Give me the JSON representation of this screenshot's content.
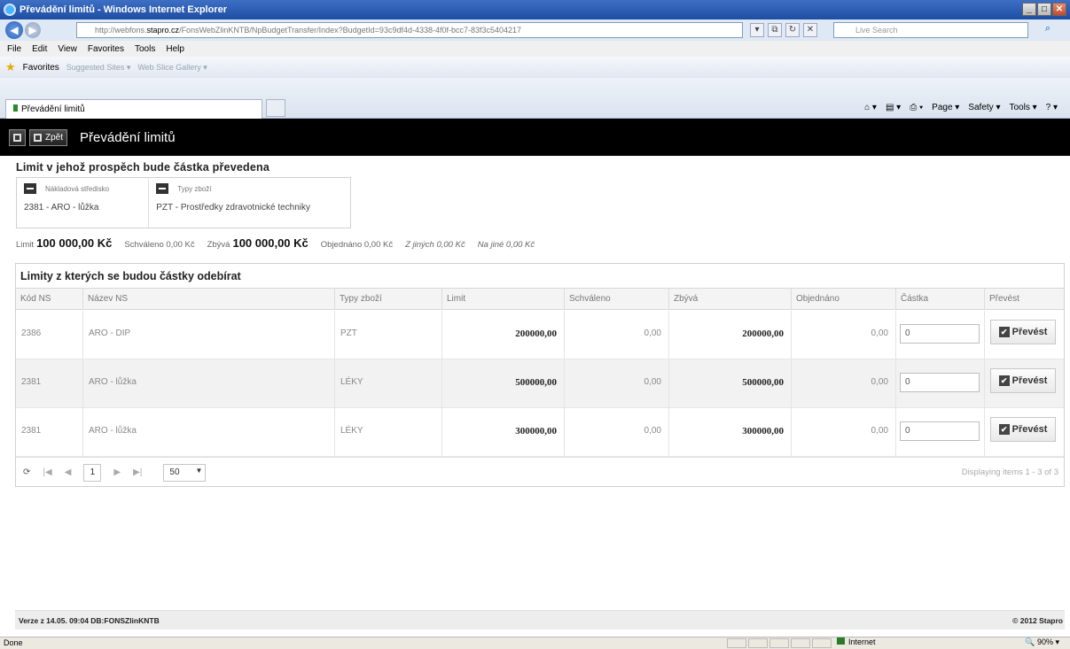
{
  "browser": {
    "window_title": "Převádění limitů - Windows Internet Explorer",
    "url_prefix": "http://webfons.",
    "url_host": "stapro.cz",
    "url_rest": "/FonsWebZlinKNTB/NpBudgetTransfer/Index?BudgetId=93c9df4d-4338-4f0f-bcc7-83f3c5404217",
    "search_placeholder": "Live Search",
    "menu": [
      "File",
      "Edit",
      "View",
      "Favorites",
      "Tools",
      "Help"
    ],
    "favorites_label": "Favorites",
    "suggested_sites": "Suggested Sites ▾",
    "web_slice": "Web Slice Gallery ▾",
    "tab_title": "Převádění limitů",
    "commands": [
      "Page ▾",
      "Safety ▾",
      "Tools ▾"
    ],
    "status_text": "Done",
    "zone": "Internet",
    "zoom": "90%"
  },
  "app": {
    "back_label": "Zpět",
    "title": "Převádění limitů",
    "target_title": "Limit v jehož prospěch bude částka převedena",
    "target_headers": [
      "Nákladová středisko",
      "Typy zboží"
    ],
    "target_values": [
      "2381 - ARO - lůžka",
      "PZT - Prostředky zdravotnické techniky"
    ],
    "summary": {
      "limit_label": "Limit",
      "limit_value": "100 000,00 Kč",
      "schvaleno": "Schváleno 0,00 Kč",
      "zbyva_label": "Zbývá",
      "zbyva_value": "100 000,00 Kč",
      "objednano": "Objednáno 0,00 Kč",
      "z_jinych": "Z jiných 0,00 Kč",
      "na_jine": "Na jiné 0,00 Kč"
    },
    "grid_title": "Limity z kterých se budou částky odebírat",
    "columns": [
      "Kód NS",
      "Název NS",
      "Typy zboží",
      "Limit",
      "Schváleno",
      "Zbývá",
      "Objednáno",
      "Částka",
      "Převést"
    ],
    "rows": [
      {
        "kod": "2386",
        "nazev": "ARO - DIP",
        "typ": "PZT",
        "limit": "200000,00",
        "schvaleno": "0,00",
        "zbyva": "200000,00",
        "objednano": "0,00",
        "castka": "0",
        "action": "Převést"
      },
      {
        "kod": "2381",
        "nazev": "ARO - lůžka",
        "typ": "LÉKY",
        "limit": "500000,00",
        "schvaleno": "0,00",
        "zbyva": "500000,00",
        "objednano": "0,00",
        "castka": "0",
        "action": "Převést"
      },
      {
        "kod": "2381",
        "nazev": "ARO - lůžka",
        "typ": "LÉKY",
        "limit": "300000,00",
        "schvaleno": "0,00",
        "zbyva": "300000,00",
        "objednano": "0,00",
        "castka": "0",
        "action": "Převést"
      }
    ],
    "pager": {
      "page": "1",
      "page_size": "50",
      "info": "Displaying items 1 - 3 of 3"
    },
    "footer_left": "Verze z 14.05. 09:04 DB:FONSZlinKNTB",
    "footer_right": "© 2012 Stapro"
  }
}
